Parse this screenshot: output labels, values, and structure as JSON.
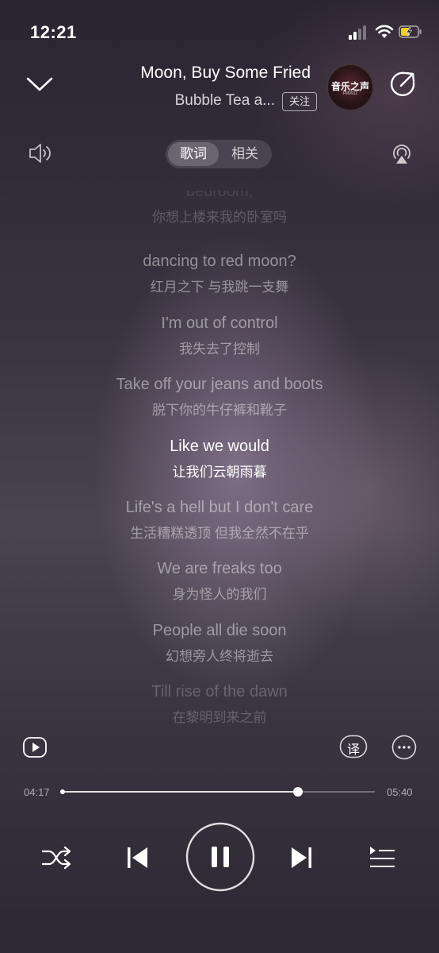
{
  "status_bar": {
    "time": "12:21"
  },
  "header": {
    "song_title": "Moon, Buy Some Fried",
    "artist": "Bubble Tea a...",
    "follow_label": "关注",
    "album_art_text": "音乐之声",
    "album_art_sub": "FM9912"
  },
  "tabs": {
    "lyrics": "歌词",
    "related": "相关",
    "selected": "歌词"
  },
  "lyrics": [
    {
      "en": "bedroom,",
      "zh": "你想上楼来我的卧室吗",
      "state": "faint"
    },
    {
      "en": "dancing to red moon?",
      "zh": "红月之下 与我跳一支舞",
      "state": "dim"
    },
    {
      "en": "I'm out of control",
      "zh": "我失去了控制",
      "state": "dim"
    },
    {
      "en": "Take off your jeans and boots",
      "zh": "脱下你的牛仔裤和靴子",
      "state": "dim"
    },
    {
      "en": "Like we would",
      "zh": "让我们云朝雨暮",
      "state": "active"
    },
    {
      "en": "Life's a hell but I don't care",
      "zh": "生活糟糕透顶 但我全然不在乎",
      "state": "dim"
    },
    {
      "en": "We are freaks too",
      "zh": "身为怪人的我们",
      "state": "dim"
    },
    {
      "en": "People all die soon",
      "zh": "幻想旁人终将逝去",
      "state": "dim"
    },
    {
      "en": "Till rise of the dawn",
      "zh": "在黎明到来之前",
      "state": "faint"
    }
  ],
  "lyric_tools": {
    "translate_label": "译"
  },
  "progress": {
    "current": "04:17",
    "total": "05:40",
    "fraction": 0.7548
  },
  "controls": {
    "icons": [
      "shuffle-icon",
      "previous-icon",
      "pause-icon",
      "next-icon",
      "playlist-icon"
    ]
  }
}
